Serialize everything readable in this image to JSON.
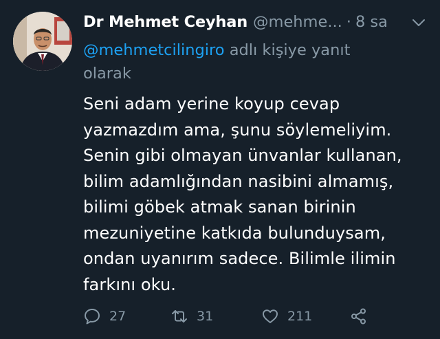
{
  "tweet": {
    "display_name": "Dr Mehmet Ceyhan",
    "handle": "@mehme...",
    "separator": "·",
    "time": "8 sa",
    "reply_to": {
      "mention": "@mehmetcilingiro",
      "suffix_line1": " adlı kişiye yanıt",
      "suffix_line2": "olarak"
    },
    "body_lines": [
      "Seni adam yerine koyup cevap",
      "yazmazdım ama, şunu söylemeliyim.",
      "Senin gibi olmayan ünvanlar kullanan,",
      "bilim adamlığından nasibini almamış,",
      "bilimi göbek atmak sanan birinin",
      "mezuniyetine katkıda bulunduysam,",
      "ondan uyanırım sadece. Bilimle ilimin",
      "farkını oku."
    ],
    "actions": {
      "replies": "27",
      "retweets": "31",
      "likes": "211"
    },
    "icons": {
      "reply": "reply-icon",
      "retweet": "retweet-icon",
      "like": "heart-icon",
      "share": "share-icon",
      "caret": "chevron-down-icon"
    },
    "colors": {
      "background": "#16202a",
      "text": "#ffffff",
      "muted": "#8899a6",
      "link": "#1da1f2"
    }
  }
}
